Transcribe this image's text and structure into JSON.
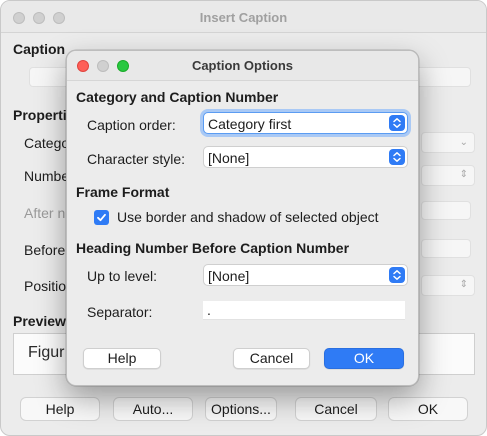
{
  "background_window": {
    "title": "Insert Caption",
    "caption_section": "Caption",
    "properties_section": "Propertie",
    "labels": {
      "category": "Catego",
      "numbering": "Numbe",
      "after": "After n",
      "before": "Before",
      "position": "Positio"
    },
    "preview_section": "Preview",
    "preview_text": "Figur",
    "buttons": {
      "help": "Help",
      "auto": "Auto...",
      "options": "Options...",
      "cancel": "Cancel",
      "ok": "OK"
    }
  },
  "dialog": {
    "title": "Caption Options",
    "sections": {
      "category_caption_number": "Category and Caption Number",
      "frame_format": "Frame Format",
      "heading_number": "Heading Number Before Caption Number"
    },
    "fields": {
      "caption_order": {
        "label": "Caption order:",
        "value": "Category first"
      },
      "character_style": {
        "label": "Character style:",
        "value": "[None]"
      },
      "border_shadow": {
        "label": "Use border and shadow of selected object",
        "checked": true
      },
      "up_to_level": {
        "label": "Up to level:",
        "value": "[None]"
      },
      "separator": {
        "label": "Separator:",
        "value": "."
      }
    },
    "buttons": {
      "help": "Help",
      "cancel": "Cancel",
      "ok": "OK"
    }
  },
  "colors": {
    "accent": "#2f7bf5",
    "focus_ring": "#a9c9f5",
    "close": "#fe5f57",
    "zoom": "#28c840"
  }
}
